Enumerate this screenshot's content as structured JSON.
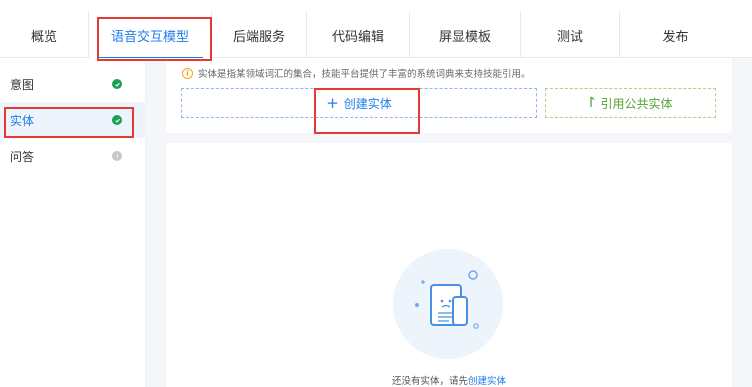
{
  "tabs": [
    {
      "label": "概览",
      "active": false
    },
    {
      "label": "语音交互模型",
      "active": true
    },
    {
      "label": "后端服务",
      "active": false
    },
    {
      "label": "代码编辑",
      "active": false
    },
    {
      "label": "屏显模板",
      "active": false
    },
    {
      "label": "测试",
      "active": false
    },
    {
      "label": "发布",
      "active": false
    }
  ],
  "sidebar": {
    "items": [
      {
        "label": "意图",
        "status": "complete"
      },
      {
        "label": "实体",
        "status": "complete",
        "active": true
      },
      {
        "label": "问答",
        "status": "incomplete"
      }
    ]
  },
  "main": {
    "notice": "实体是指某领域词汇的集合，技能平台提供了丰富的系统词典来支持技能引用。",
    "create_button": "创建实体",
    "create_plus": "+",
    "public_button": "引用公共实体",
    "empty_text": "还没有实体，请先",
    "empty_link": "创建实体"
  },
  "colors": {
    "accent": "#1e7df0",
    "success": "#1c9e53",
    "public": "#52a335",
    "highlight": "#e53935"
  },
  "icons": {
    "check": "check-circle-icon",
    "pending": "pending-circle-icon",
    "info": "info-icon",
    "reference": "reference-icon",
    "empty": "empty-document-illustration"
  }
}
